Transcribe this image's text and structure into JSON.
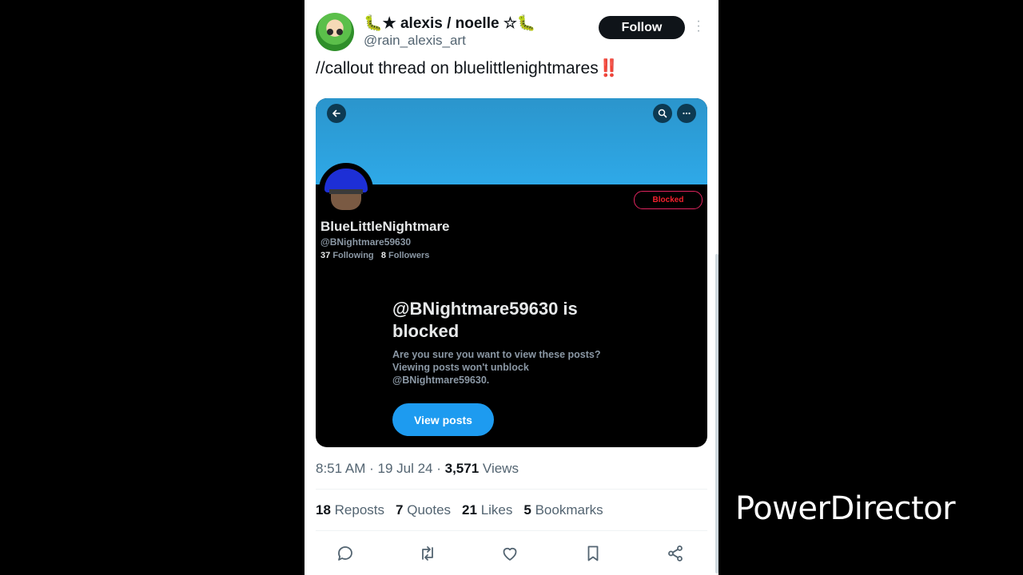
{
  "tweet": {
    "display_name": "🐛★ alexis / noelle ☆🐛",
    "handle": "@rain_alexis_art",
    "follow_label": "Follow",
    "text": "//callout thread on bluelittlenightmares",
    "text_emoji": "‼️",
    "time": "8:51 AM",
    "date": "19 Jul 24",
    "views_count": "3,571",
    "views_label": "Views",
    "stats": [
      {
        "count": "18",
        "label": "Reposts"
      },
      {
        "count": "7",
        "label": "Quotes"
      },
      {
        "count": "21",
        "label": "Likes"
      },
      {
        "count": "5",
        "label": "Bookmarks"
      }
    ],
    "actions": [
      "reply-icon",
      "repost-icon",
      "like-icon",
      "bookmark-icon",
      "share-icon"
    ]
  },
  "embedded_profile": {
    "name": "BlueLittleNightmare",
    "handle": "@BNightmare59630",
    "following_count": "37",
    "following_label": "Following",
    "followers_count": "8",
    "followers_label": "Followers",
    "blocked_badge": "Blocked",
    "blocked_title": "@BNightmare59630 is blocked",
    "blocked_desc": "Are you sure you want to view these posts? Viewing posts won't unblock @BNightmare59630.",
    "view_posts_label": "View posts",
    "banner_color": "#2ea9e8"
  },
  "watermark": "PowerDirector",
  "colors": {
    "accent": "#1d9bf0",
    "blocked": "#f4212e",
    "text": "#0f1419",
    "muted": "#536471"
  }
}
